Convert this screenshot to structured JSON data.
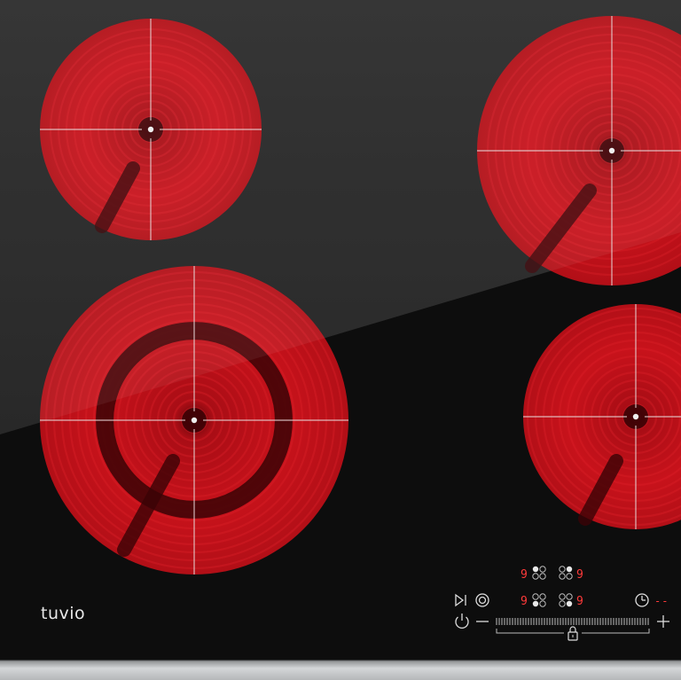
{
  "brand": {
    "name": "tuvio"
  },
  "controls": {
    "zone_levels": [
      {
        "zone": "rear-left",
        "level": "9"
      },
      {
        "zone": "rear-right",
        "level": "9"
      },
      {
        "zone": "front-left",
        "level": "9"
      },
      {
        "zone": "front-right",
        "level": "9"
      }
    ],
    "timer_display": "--",
    "icons": [
      "power-icon",
      "minus-icon",
      "slider",
      "plus-icon",
      "lock-icon",
      "play-pause-icon",
      "boost-icon",
      "timer-icon"
    ]
  },
  "colors": {
    "glass": "#141414",
    "hot_zone": "#c4121b",
    "display_red": "#ff3030",
    "frame": "#c9cbcd"
  }
}
